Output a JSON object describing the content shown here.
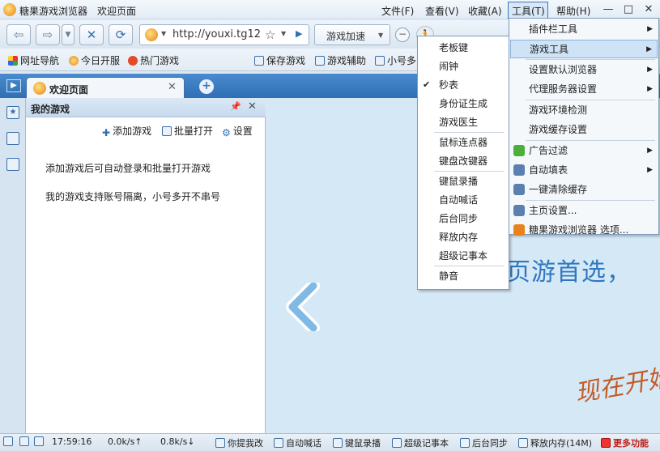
{
  "window": {
    "app_title": "糖果游戏浏览器",
    "page_title": "欢迎页面",
    "menus": [
      "文件(F)",
      "查看(V)",
      "收藏(A)",
      "工具(T)",
      "帮助(H)"
    ],
    "controls": [
      "—",
      "□",
      "✕"
    ]
  },
  "navbar": {
    "url": "http://youxi.tg12",
    "accel_label": "游戏加速"
  },
  "bookmarks": {
    "left": [
      "网址导航",
      "今日开服",
      "热门游戏"
    ],
    "right": [
      "保存游戏",
      "游戏辅助",
      "小号多"
    ]
  },
  "tabs": {
    "active_label": "欢迎页面",
    "new_tab": "+"
  },
  "panel": {
    "title": "我的游戏",
    "actions": [
      "添加游戏",
      "批量打开",
      "设置"
    ],
    "lines": [
      "添加游戏后可自动登录和批量打开游戏",
      "我的游戏支持账号隔离，小号多开不串号"
    ]
  },
  "main": {
    "banner_text": "页游首选，",
    "deco_text": "现在开始"
  },
  "statusbar": {
    "time": "17:59:16",
    "up": "0.0k/s↑",
    "down": "0.8k/s↓",
    "items": [
      "你提我改",
      "自动喊话",
      "键鼠录播",
      "超级记事本",
      "后台同步",
      "释放内存(14M)",
      "更多功能"
    ]
  },
  "game_tools_submenu": {
    "groups": [
      [
        "老板键",
        "闹钟",
        "秒表",
        "身份证生成",
        "游戏医生"
      ],
      [
        "鼠标连点器",
        "键盘改键器"
      ],
      [
        "键鼠录播",
        "自动喊话",
        "后台同步",
        "释放内存",
        "超级记事本"
      ],
      [
        "静音"
      ]
    ],
    "checked_item": "秒表",
    "check_mark": "✔"
  },
  "tools_menu": {
    "groups": [
      [
        "插件栏工具",
        "游戏工具"
      ],
      [
        "设置默认浏览器",
        "代理服务器设置"
      ],
      [
        "游戏环境检测",
        "游戏缓存设置"
      ],
      [
        "广告过滤",
        "自动填表",
        "一键清除缓存"
      ],
      [
        "主页设置...",
        "糖果游戏浏览器 选项..."
      ]
    ],
    "highlighted_item": "游戏工具",
    "submenu_arrow": "▶"
  }
}
